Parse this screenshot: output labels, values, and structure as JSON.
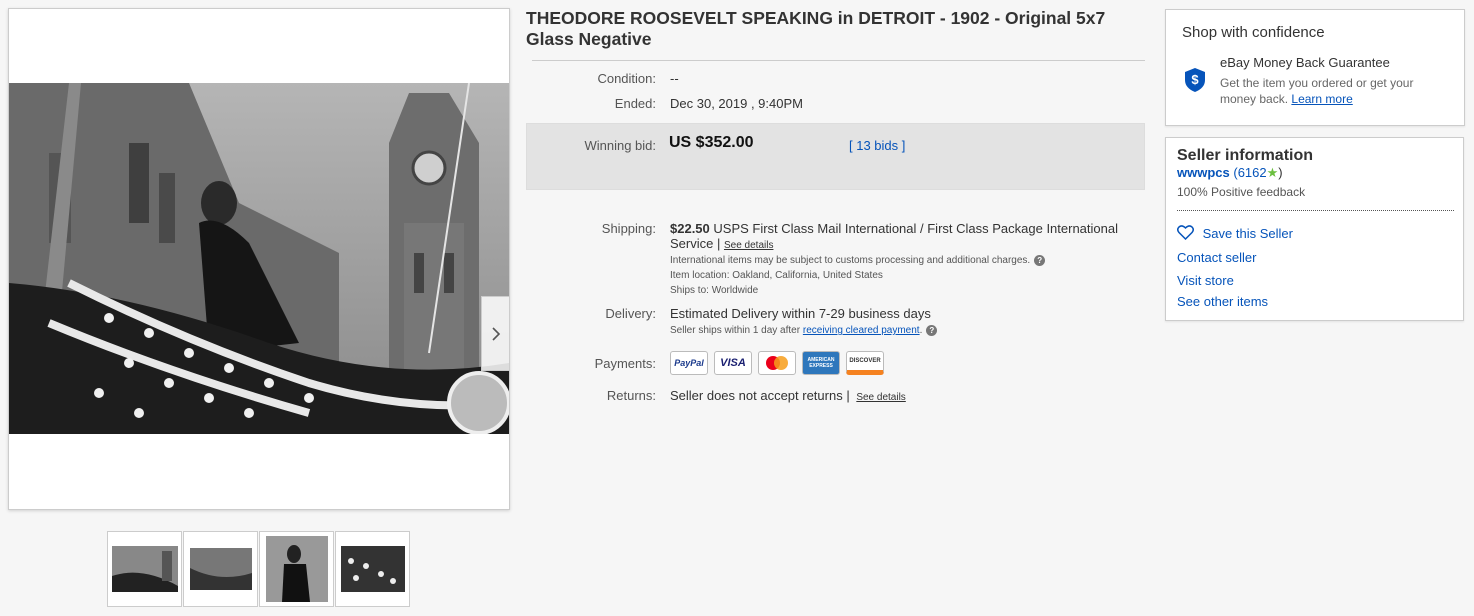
{
  "listing": {
    "title": "THEODORE ROOSEVELT SPEAKING in DETROIT - 1902 - Original 5x7 Glass Negative",
    "condition_label": "Condition:",
    "condition_value": "--",
    "ended_label": "Ended:",
    "ended_value": "Dec 30, 2019 , 9:40PM",
    "bid_label": "Winning bid:",
    "bid_value": "US $352.00",
    "bids_link": "[ 13 bids ]"
  },
  "shipping": {
    "label": "Shipping:",
    "cost": "$22.50",
    "service": "USPS First Class Mail International / First Class Package International Service |",
    "details_link": "See details",
    "customs_note": "International items may be subject to customs processing and additional charges.",
    "location_label": "Item location:",
    "location": "Oakland, California, United States",
    "ships_to_label": "Ships to:",
    "ships_to": "Worldwide"
  },
  "delivery": {
    "label": "Delivery:",
    "estimate": "Estimated Delivery within 7-29 business days",
    "note_prefix": "Seller ships within 1 day after",
    "note_link": "receiving cleared payment",
    "note_suffix": "."
  },
  "payments": {
    "label": "Payments:",
    "methods": [
      "PayPal",
      "VISA",
      "mastercard",
      "AMERICAN EXPRESS",
      "DISCOVER"
    ]
  },
  "returns": {
    "label": "Returns:",
    "text": "Seller does not accept returns |",
    "details_link": "See details"
  },
  "confidence": {
    "heading": "Shop with confidence",
    "guarantee_title": "eBay Money Back Guarantee",
    "guarantee_text": "Get the item you ordered or get your money back.",
    "learn_more": "Learn more"
  },
  "seller": {
    "heading": "Seller information",
    "username": "wwwpcs",
    "feedback_open": "(6162",
    "feedback_close": ")",
    "positive": "100% Positive feedback",
    "save": "Save this Seller",
    "contact": "Contact seller",
    "store": "Visit store",
    "other": "See other items"
  },
  "colors": {
    "link": "#0654ba",
    "bid_box": "#e3e3e3",
    "star": "#6bbf3f"
  }
}
